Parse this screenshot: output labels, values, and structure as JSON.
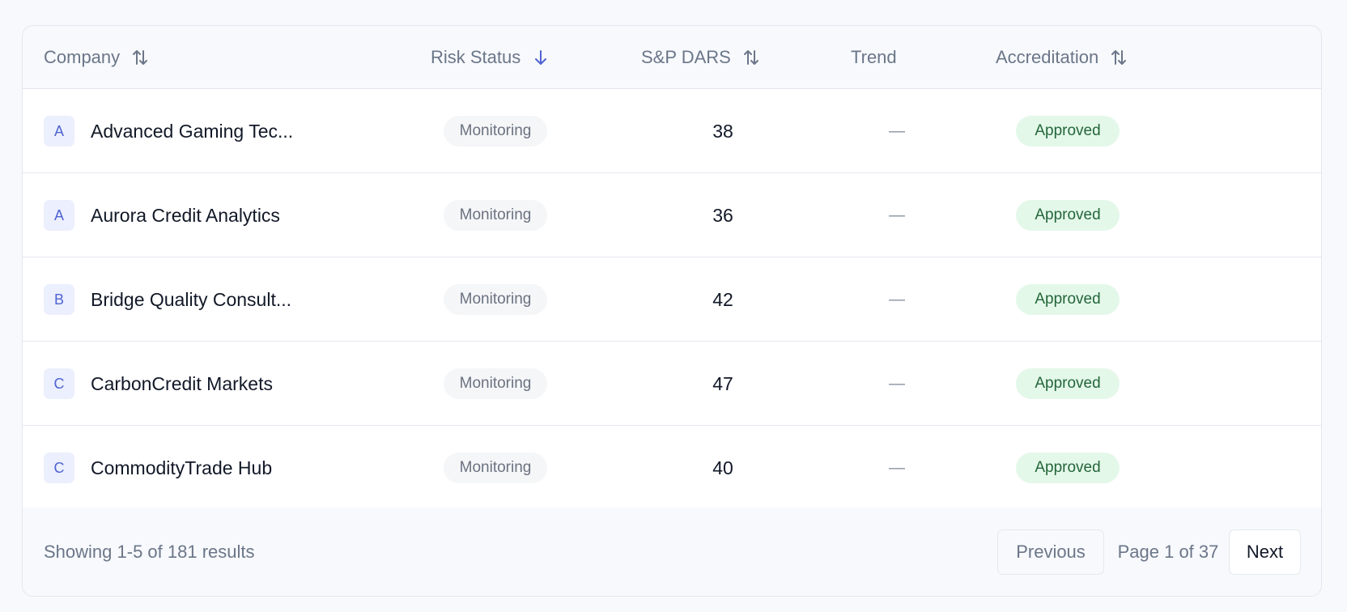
{
  "table": {
    "columns": {
      "company": {
        "label": "Company",
        "sort_icon": "sort-both-icon"
      },
      "risk_status": {
        "label": "Risk Status",
        "sort_icon": "sort-down-icon"
      },
      "sp_dars": {
        "label": "S&P DARS",
        "sort_icon": "sort-both-icon"
      },
      "trend": {
        "label": "Trend"
      },
      "accreditation": {
        "label": "Accreditation",
        "sort_icon": "sort-both-icon"
      }
    },
    "rows": [
      {
        "initial": "A",
        "company": "Advanced Gaming Tec...",
        "risk_status": "Monitoring",
        "sp_dars": "38",
        "trend": "—",
        "accreditation": "Approved"
      },
      {
        "initial": "A",
        "company": "Aurora Credit Analytics",
        "risk_status": "Monitoring",
        "sp_dars": "36",
        "trend": "—",
        "accreditation": "Approved"
      },
      {
        "initial": "B",
        "company": "Bridge Quality Consult...",
        "risk_status": "Monitoring",
        "sp_dars": "42",
        "trend": "—",
        "accreditation": "Approved"
      },
      {
        "initial": "C",
        "company": "CarbonCredit Markets",
        "risk_status": "Monitoring",
        "sp_dars": "47",
        "trend": "—",
        "accreditation": "Approved"
      },
      {
        "initial": "C",
        "company": "CommodityTrade Hub",
        "risk_status": "Monitoring",
        "sp_dars": "40",
        "trend": "—",
        "accreditation": "Approved"
      }
    ]
  },
  "footer": {
    "showing": "Showing 1-5 of 181 results",
    "previous_label": "Previous",
    "page_info": "Page 1 of 37",
    "next_label": "Next"
  },
  "colors": {
    "accent": "#4f63d2",
    "muted_text": "#6b7689",
    "approved_bg": "#e4f8ea",
    "approved_text": "#24663a",
    "monitoring_bg": "#f5f6f8"
  }
}
